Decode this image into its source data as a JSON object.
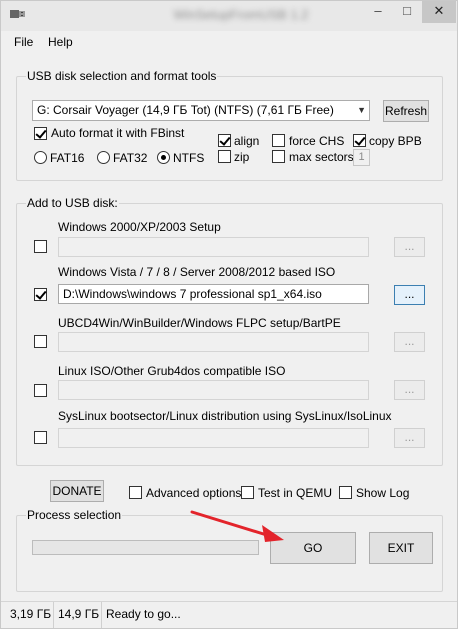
{
  "window": {
    "title": "WinSetupFromUSB 1.2"
  },
  "menu": {
    "file": "File",
    "help": "Help"
  },
  "usb_group": {
    "title": "USB disk selection and format tools",
    "disk_selected": "G: Corsair Voyager (14,9 ГБ Tot) (NTFS) (7,61 ГБ Free)",
    "refresh_label": "Refresh",
    "auto_format_label": "Auto format it with FBinst",
    "auto_format_checked": true,
    "fs_options": [
      {
        "label": "FAT16",
        "selected": false
      },
      {
        "label": "FAT32",
        "selected": false
      },
      {
        "label": "NTFS",
        "selected": true
      }
    ],
    "align_label": "align",
    "align_checked": true,
    "zip_label": "zip",
    "zip_checked": false,
    "force_chs_label": "force CHS",
    "force_chs_checked": false,
    "max_sectors_label": "max sectors",
    "max_sectors_checked": false,
    "max_sectors_value": "1",
    "copy_bpb_label": "copy BPB",
    "copy_bpb_checked": true
  },
  "add_group": {
    "title": "Add to USB disk:",
    "browse_label": "...",
    "items": [
      {
        "label": "Windows 2000/XP/2003 Setup",
        "checked": false,
        "path": ""
      },
      {
        "label": "Windows Vista / 7 / 8 / Server 2008/2012 based ISO",
        "checked": true,
        "path": "D:\\Windows\\windows 7 professional sp1_x64.iso"
      },
      {
        "label": "UBCD4Win/WinBuilder/Windows FLPC setup/BartPE",
        "checked": false,
        "path": ""
      },
      {
        "label": "Linux ISO/Other Grub4dos compatible ISO",
        "checked": false,
        "path": ""
      },
      {
        "label": "SysLinux bootsector/Linux distribution using SysLinux/IsoLinux",
        "checked": false,
        "path": ""
      }
    ]
  },
  "options": {
    "donate_label": "DONATE",
    "advanced_label": "Advanced options",
    "advanced_checked": false,
    "qemu_label": "Test in QEMU",
    "qemu_checked": false,
    "showlog_label": "Show Log",
    "showlog_checked": false
  },
  "process": {
    "title": "Process selection",
    "progress": 0,
    "go_label": "GO",
    "exit_label": "EXIT"
  },
  "status": {
    "free": "3,19 ГБ",
    "total": "14,9 ГБ",
    "message": "Ready to go..."
  },
  "annotation": {
    "arrow_color": "#e3242b"
  }
}
